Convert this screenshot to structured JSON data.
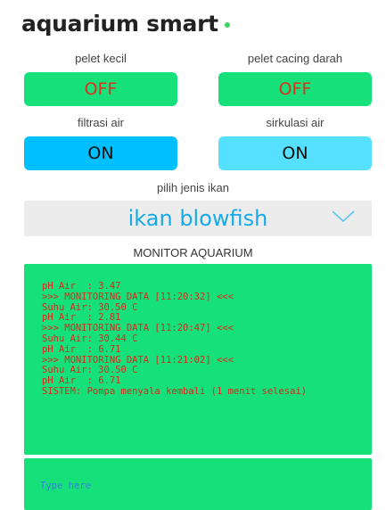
{
  "header": {
    "title": "aquarium smart"
  },
  "controls": [
    {
      "label": "pelet kecil",
      "state": "OFF"
    },
    {
      "label": "pelet cacing darah",
      "state": "OFF"
    },
    {
      "label": "filtrasi air",
      "state": "ON"
    },
    {
      "label": "sirkulasi air",
      "state": "ON"
    }
  ],
  "fish_selector": {
    "label": "pilih jenis ikan",
    "selected": "ikan blowfish",
    "icon": "chevron-down-icon"
  },
  "monitor": {
    "title": "MONITOR AQUARIUM",
    "lines": [
      "pH Air  : 3.47",
      ">>> MONITORING DATA [11:20:32] <<<",
      "Suhu Air: 30.50 C",
      "pH Air  : 2.81",
      ">>> MONITORING DATA [11:20:47] <<<",
      "Suhu Air: 30.44 C",
      "pH Air  : 6.71",
      ">>> MONITORING DATA [11:21:02] <<<",
      "Suhu Air: 30.50 C",
      "pH Air  : 6.71",
      "SISTEM: Pompa menyala kembali (1 menit selesai)"
    ]
  },
  "input": {
    "placeholder": "Type here",
    "value": ""
  },
  "colors": {
    "green": "#16e07a",
    "off_text": "#e0301e",
    "on_dark": "#00bfff",
    "on_light": "#56e0ff",
    "select_text": "#18a9e8",
    "log_text": "#d72a1f"
  }
}
